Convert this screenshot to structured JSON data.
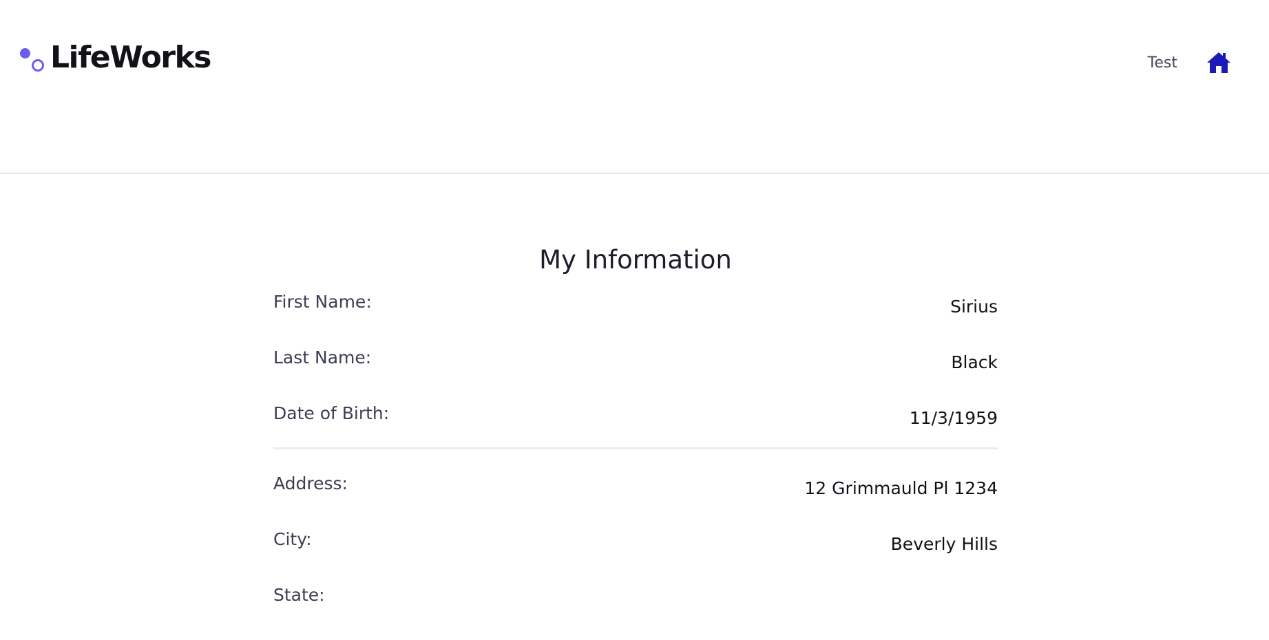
{
  "header": {
    "brand": "LifeWorks",
    "user_name": "Test",
    "home_icon": "home-icon",
    "accent_color": "#6e5cf2",
    "home_icon_color": "#1a1ab8"
  },
  "main": {
    "title": "My Information",
    "personal": [
      {
        "label": "First Name:",
        "value": "Sirius"
      },
      {
        "label": "Last Name:",
        "value": "Black"
      },
      {
        "label": "Date of Birth:",
        "value": "11/3/1959"
      }
    ],
    "address": [
      {
        "label": "Address:",
        "value": "12 Grimmauld Pl 1234"
      },
      {
        "label": "City:",
        "value": "Beverly Hills"
      },
      {
        "label": "State:",
        "value": ""
      }
    ]
  }
}
